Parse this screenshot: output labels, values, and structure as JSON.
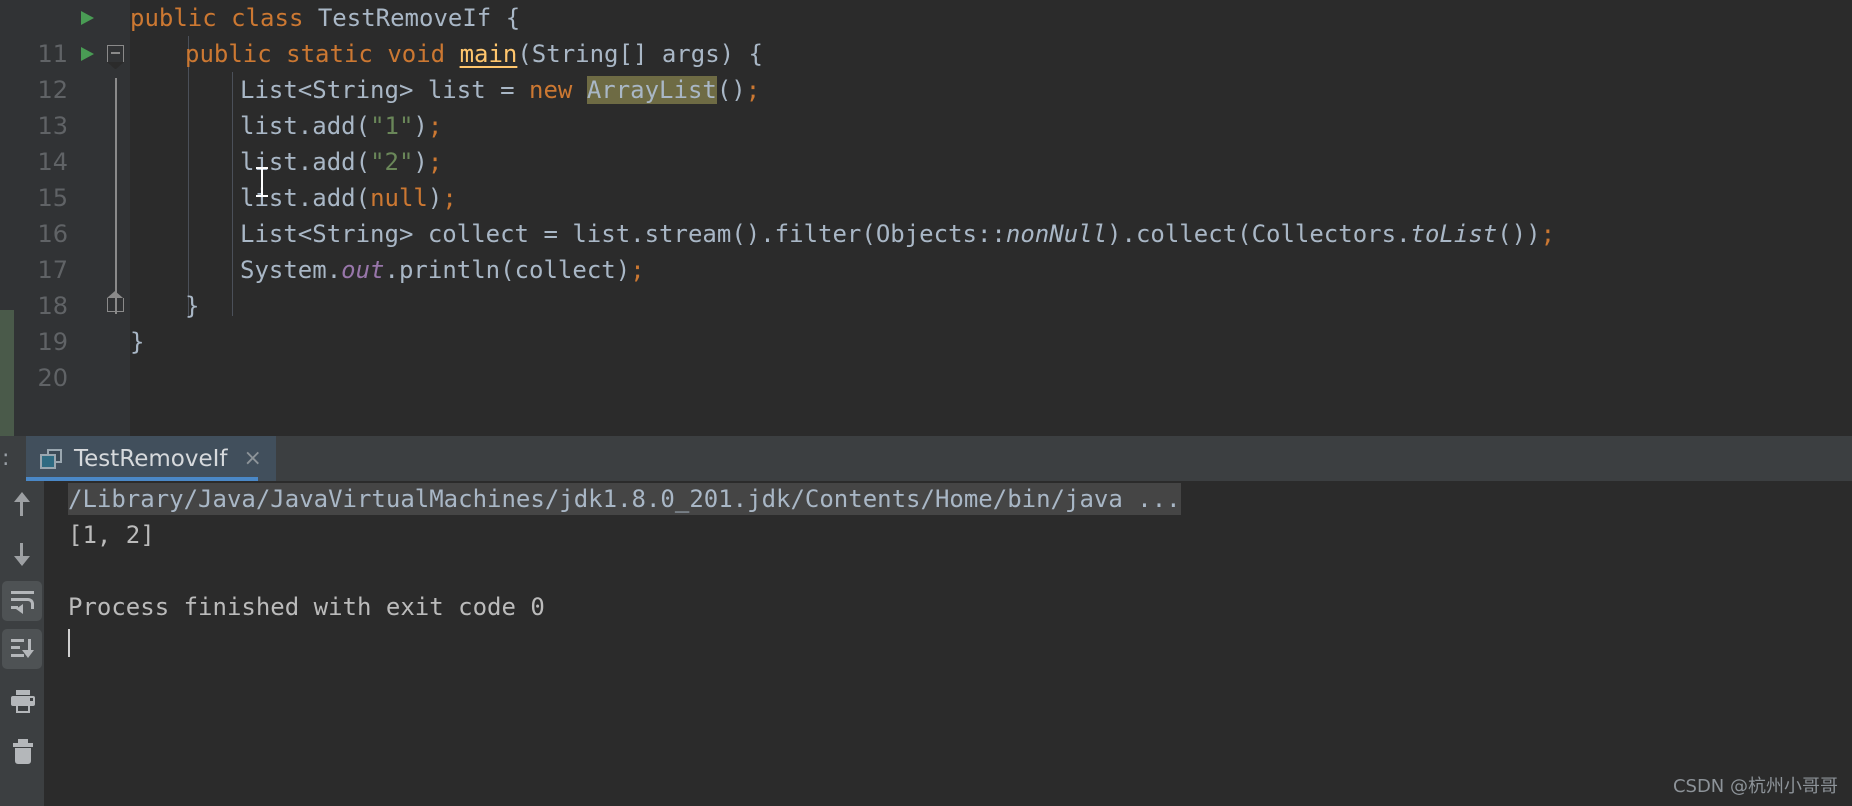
{
  "editor": {
    "lines": [
      {
        "number": "11",
        "has_run_arrow": true,
        "fold": "none",
        "indent": 0,
        "text": "public class TestRemoveIf {"
      },
      {
        "number": "12",
        "has_run_arrow": true,
        "fold": "minus",
        "indent": 1,
        "text": "public static void main(String[] args) {"
      },
      {
        "number": "13",
        "has_run_arrow": false,
        "fold": "none",
        "indent": 2,
        "text": "List<String> list = new ArrayList();"
      },
      {
        "number": "14",
        "has_run_arrow": false,
        "fold": "none",
        "indent": 2,
        "text": "list.add(\"1\");"
      },
      {
        "number": "15",
        "has_run_arrow": false,
        "fold": "none",
        "indent": 2,
        "text": "list.add(\"2\");"
      },
      {
        "number": "16",
        "has_run_arrow": false,
        "fold": "none",
        "indent": 2,
        "text": "list.add(null);"
      },
      {
        "number": "17",
        "has_run_arrow": false,
        "fold": "none",
        "indent": 2,
        "text": "List<String> collect = list.stream().filter(Objects::nonNull).collect(Collectors.toList());"
      },
      {
        "number": "18",
        "has_run_arrow": false,
        "fold": "none",
        "indent": 2,
        "text": "System.out.println(collect);"
      },
      {
        "number": "19",
        "has_run_arrow": false,
        "fold": "end",
        "indent": 1,
        "text": "}"
      },
      {
        "number": "20",
        "has_run_arrow": false,
        "fold": "none",
        "indent": 0,
        "text": "}"
      }
    ],
    "tokens": {
      "keyword_public": "public",
      "keyword_class": "class",
      "keyword_static": "static",
      "keyword_void": "void",
      "keyword_new": "new",
      "keyword_null": "null",
      "class_name": "TestRemoveIf",
      "method_main": "main",
      "type_list": "List<String>",
      "type_string_args": "(String[] args) {",
      "var_list": "list",
      "var_collect": "collect",
      "highlighted_identifier": "ArrayList",
      "str_one": "\"1\"",
      "str_two": "\"2\"",
      "static_field_out": "out",
      "static_method_nonnull": "nonNull",
      "static_method_tolist": "toList",
      "class_objects": "Objects",
      "class_collectors": "Collectors",
      "class_system": "System",
      "method_add": "add",
      "method_println": "println",
      "method_stream": "stream",
      "method_filter": "filter",
      "method_collect": "collect"
    }
  },
  "console": {
    "tab_prefix_dots": ":",
    "tab": {
      "label": "TestRemoveIf",
      "close_label": "×",
      "icon": "console-window-icon",
      "active": true
    },
    "toolbar": [
      {
        "name": "prev-occurrence-button",
        "icon": "arrow-up-icon",
        "label": "Up the Stack Trace",
        "selected": false
      },
      {
        "name": "next-occurrence-button",
        "icon": "arrow-down-icon",
        "label": "Down the Stack Trace",
        "selected": false
      },
      {
        "name": "soft-wrap-button",
        "icon": "soft-wrap-icon",
        "label": "Soft-Wrap",
        "selected": true
      },
      {
        "name": "scroll-to-end-button",
        "icon": "scroll-to-end-icon",
        "label": "Scroll to the end",
        "selected": true
      },
      {
        "name": "print-button",
        "icon": "printer-icon",
        "label": "Print",
        "selected": false
      },
      {
        "name": "clear-all-button",
        "icon": "trash-icon",
        "label": "Clear All",
        "selected": false
      }
    ],
    "output": [
      {
        "text": "/Library/Java/JavaVirtualMachines/jdk1.8.0_201.jdk/Contents/Home/bin/java ...",
        "highlight": true
      },
      {
        "text": "[1, 2]",
        "highlight": false
      },
      {
        "text": "",
        "highlight": false
      },
      {
        "text": "Process finished with exit code 0",
        "highlight": false
      }
    ]
  },
  "watermark": {
    "text": "CSDN @杭州小哥哥"
  },
  "colors": {
    "editor_bg": "#2b2b2b",
    "gutter_bg": "#313335",
    "toolwindow_bg": "#3c3f41",
    "keyword": "#cc7832",
    "string": "#6a8759",
    "method": "#ffc66d",
    "static_field": "#9876aa",
    "text": "#a9b7c6",
    "identifier_highlight": "#6e6b44",
    "tab_accent": "#4a88c7",
    "run_arrow": "#499c54"
  }
}
